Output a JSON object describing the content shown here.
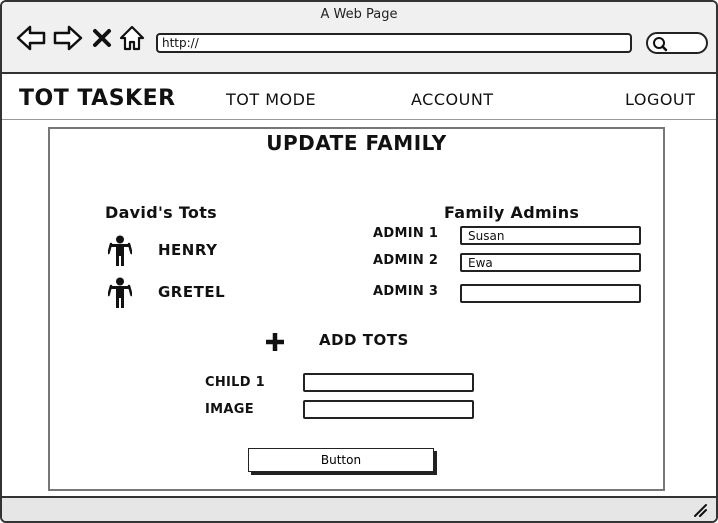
{
  "window": {
    "title": "A Web Page"
  },
  "browser": {
    "url": "http://"
  },
  "header": {
    "brand": "TOT TASKER",
    "nav": {
      "tot_mode": "TOT MODE",
      "account": "ACCOUNT",
      "logout": "LOGOUT"
    }
  },
  "page": {
    "title": "UPDATE FAMILY"
  },
  "tots": {
    "title": "David's Tots",
    "items": [
      {
        "name": "HENRY"
      },
      {
        "name": "GRETEL"
      }
    ]
  },
  "admins": {
    "title": "Family Admins",
    "items": [
      {
        "label": "ADMIN 1",
        "value": "Susan"
      },
      {
        "label": "ADMIN 2",
        "value": "Ewa"
      },
      {
        "label": "ADMIN 3",
        "value": ""
      }
    ]
  },
  "add_tots": {
    "label": "ADD TOTS",
    "child_label": "CHILD 1",
    "child_value": "",
    "image_label": "IMAGE",
    "image_value": ""
  },
  "submit": {
    "label": "Button"
  }
}
